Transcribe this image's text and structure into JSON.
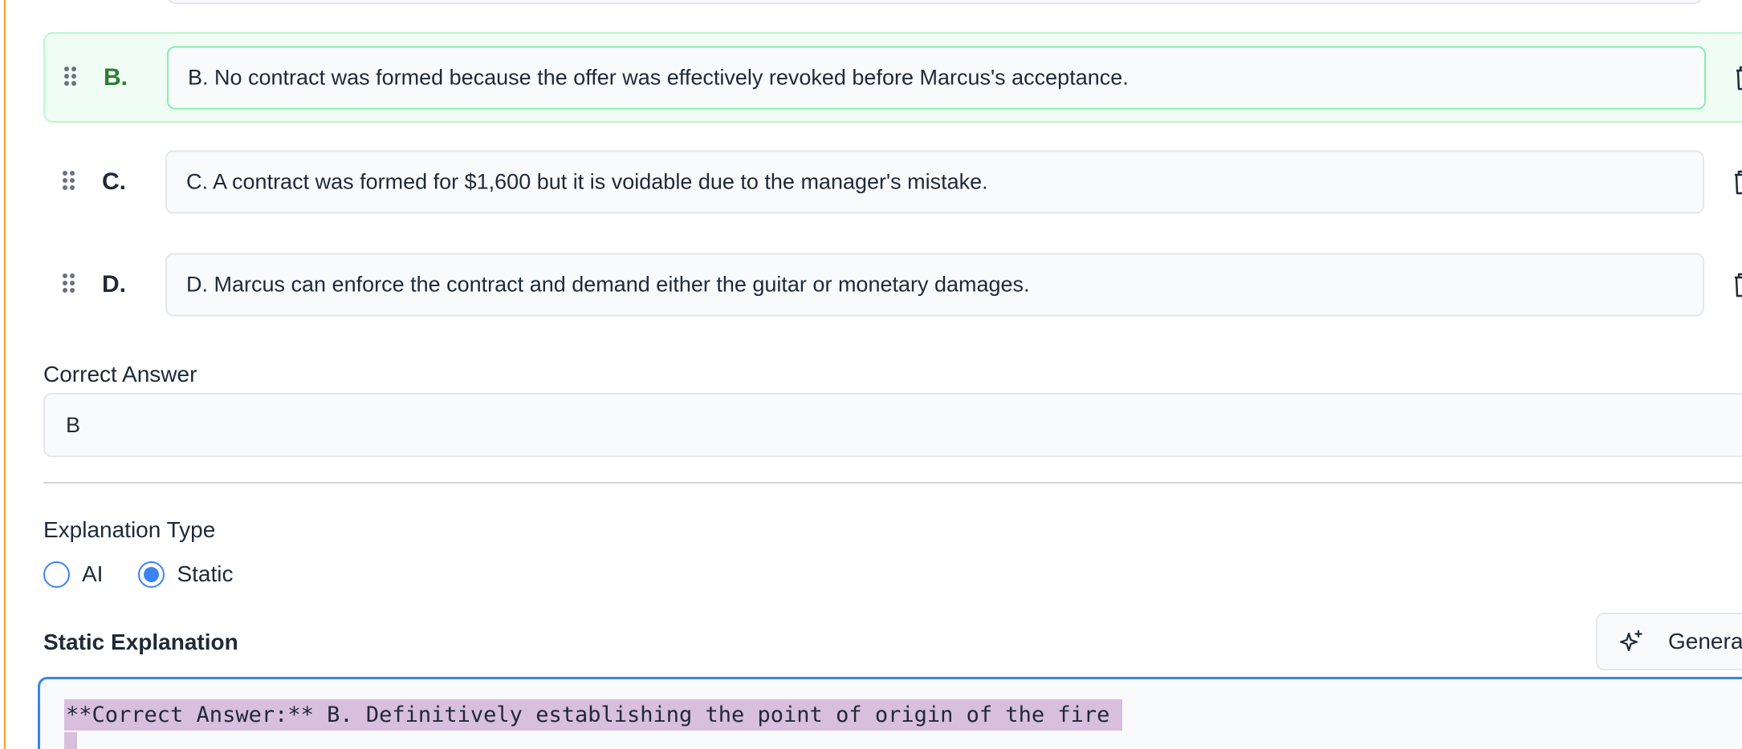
{
  "options": [
    {
      "letter": "B.",
      "text": "B. No contract was formed because the offer was effectively revoked before Marcus's acceptance.",
      "selected": true
    },
    {
      "letter": "C.",
      "text": "C. A contract was formed for $1,600 but it is voidable due to the manager's mistake.",
      "selected": false
    },
    {
      "letter": "D.",
      "text": "D. Marcus can enforce the contract and demand either the guitar or monetary damages.",
      "selected": false
    }
  ],
  "correct_answer": {
    "label": "Correct Answer",
    "value": "B"
  },
  "explanation_type": {
    "label": "Explanation Type",
    "options": [
      "AI",
      "Static"
    ],
    "selected": "Static"
  },
  "static_explanation": {
    "label": "Static Explanation",
    "generate_label": "Genera",
    "content_line_1": "**Correct Answer:** B. Definitively establishing the point of origin of the fire"
  },
  "colors": {
    "accent_blue": "#3b82f6",
    "selected_green": "#2f7d32",
    "selected_bg": "#f0fdf4",
    "left_accent": "#f5a623",
    "text_highlight": "#d8bfdd"
  }
}
